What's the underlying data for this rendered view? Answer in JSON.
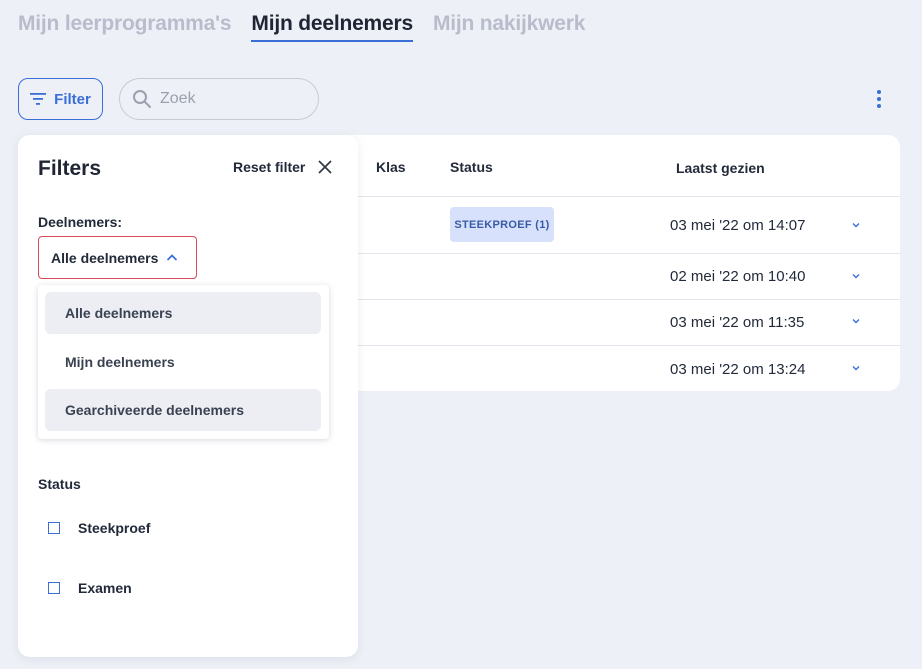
{
  "tabs": [
    {
      "label": "Mijn leerprogramma's"
    },
    {
      "label": "Mijn deelnemers"
    },
    {
      "label": "Mijn nakijkwerk"
    }
  ],
  "toolbar": {
    "filter_label": "Filter",
    "search_placeholder": "Zoek"
  },
  "table": {
    "headers": {
      "klas": "Klas",
      "status": "Status",
      "last_seen": "Laatst gezien"
    },
    "rows": [
      {
        "status": "STEEKPROEF (1)",
        "last_seen": "03 mei '22 om 14:07"
      },
      {
        "status": "",
        "last_seen": "02 mei '22 om 10:40"
      },
      {
        "status": "",
        "last_seen": "03 mei '22 om 11:35"
      },
      {
        "status": "",
        "last_seen": "03 mei '22 om 13:24"
      }
    ]
  },
  "filters": {
    "title": "Filters",
    "reset_label": "Reset filter",
    "participants_label": "Deelnemers:",
    "selected": "Alle deelnemers",
    "options": [
      "Alle deelnemers",
      "Mijn deelnemers",
      "Gearchiveerde deelnemers"
    ],
    "status_label": "Status",
    "status_options": [
      "Steekproef",
      "Examen"
    ]
  },
  "colors": {
    "accent": "#3a6fd8",
    "badge_bg": "#d8e1fb",
    "select_border": "#d64a5b"
  }
}
